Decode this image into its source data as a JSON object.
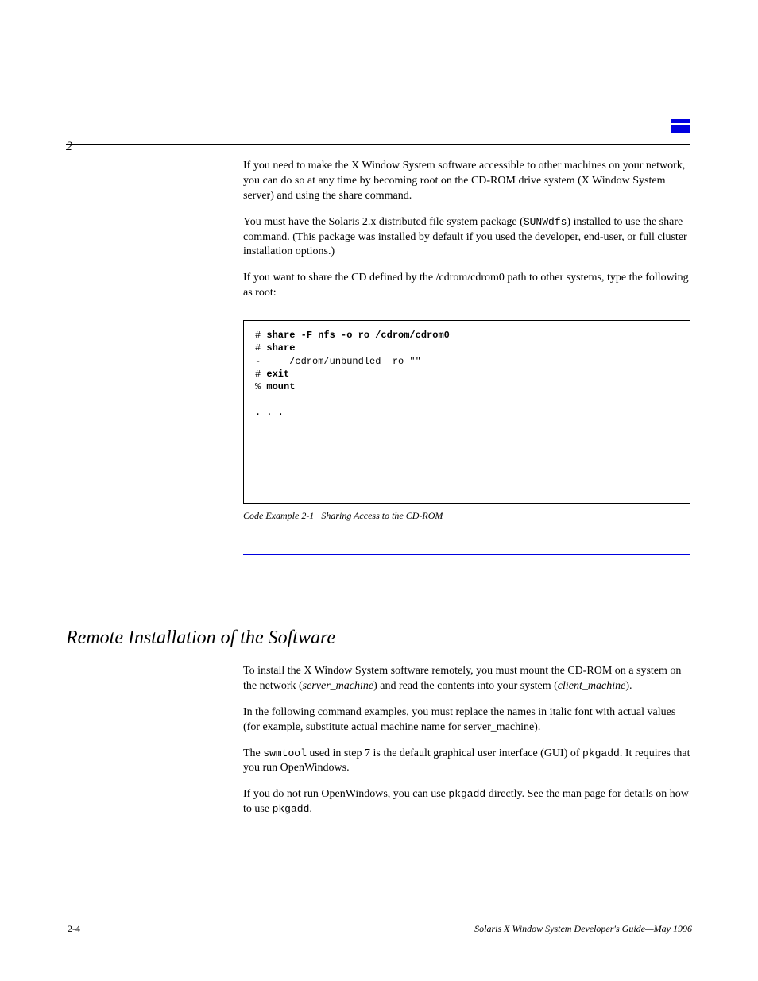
{
  "chapter": "2",
  "paragraphs": {
    "p1": "If you need to make the X Window System software accessible to other machines on your network, you can do so at any time by becoming root on the CD-ROM drive system (X Window System server) and using the share command.",
    "p2_a": "You must have the Solaris 2.x distributed file system package (",
    "p2_code": "SUNWdfs",
    "p2_b": ") installed to use the share command. (This package was installed by default if you used the developer, end-user, or full cluster installation options.)",
    "p3": "If you want to share the CD defined by the /cdrom/cdrom0 path to other systems, type the following as root:"
  },
  "code": {
    "l1_prompt": "# ",
    "l1_cmd": "share -F nfs -o ro /cdrom/cdrom0",
    "l2_prompt": "# ",
    "l2_cmd": "share",
    "l3": "-     /cdrom/unbundled  ro \"\"",
    "l4_prompt": "# ",
    "l4_cmd": "exit",
    "l5_prompt": "% ",
    "l5_cmd": "mount",
    "trail": ". . ."
  },
  "code_example": {
    "label": "Code Example 2-1",
    "title": "Sharing Access to the CD-ROM"
  },
  "section_heading": "Remote Installation of the Software",
  "after": {
    "p1_a": "To install the X Window System software remotely, you must mount the CD-ROM on a system on the network (",
    "p1_i": "server_machine",
    "p1_b": ") and read the contents into your system (",
    "p1_i2": "client_machine",
    "p1_c": ").",
    "p2": "In the following command examples, you must replace the names in italic font with actual values (for example, substitute actual machine name for server_machine).",
    "p3_a": "The ",
    "p3_code": "swmtool",
    "p3_b": " used in step 7 is the default graphical user interface (GUI) of ",
    "p3_code2": "pkgadd",
    "p3_c": ". It requires that you run OpenWindows.",
    "p4_a": "If you do not run OpenWindows, you can use ",
    "p4_code": "pkgadd",
    "p4_b": " directly. See the man page for details on how to use ",
    "p4_code2": "pkgadd",
    "p4_c": "."
  },
  "footer": {
    "page": "2-4",
    "title": "Solaris X Window System Developer's Guide",
    "date": "—May 1996"
  }
}
